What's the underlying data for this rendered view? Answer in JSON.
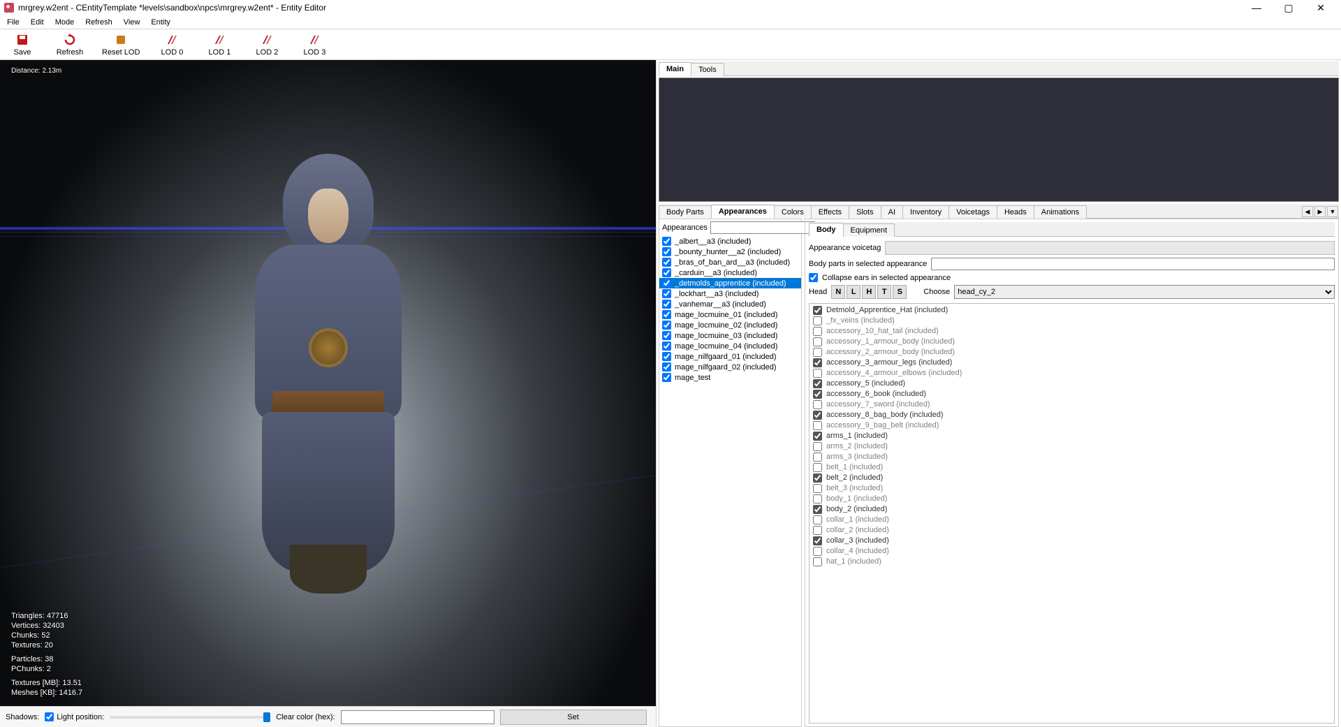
{
  "window": {
    "title": "mrgrey.w2ent - CEntityTemplate *levels\\sandbox\\npcs\\mrgrey.w2ent* - Entity Editor"
  },
  "menu": [
    "File",
    "Edit",
    "Mode",
    "Refresh",
    "View",
    "Entity"
  ],
  "toolbar": [
    {
      "name": "save",
      "label": "Save",
      "color": "#c21818"
    },
    {
      "name": "refresh",
      "label": "Refresh",
      "color": "#c21818"
    },
    {
      "name": "reset-lod",
      "label": "Reset LOD",
      "color": "#c97a1f"
    },
    {
      "name": "lod0",
      "label": "LOD 0",
      "color": "#b31a2a"
    },
    {
      "name": "lod1",
      "label": "LOD 1",
      "color": "#b31a2a"
    },
    {
      "name": "lod2",
      "label": "LOD 2",
      "color": "#b31a2a"
    },
    {
      "name": "lod3",
      "label": "LOD 3",
      "color": "#b31a2a"
    }
  ],
  "viewport": {
    "distance": "Distance: 2.13m",
    "stats": {
      "triangles": "Triangles: 47716",
      "vertices": "Vertices: 32403",
      "chunks": "Chunks: 52",
      "textures": "Textures: 20",
      "particles": "Particles: 38",
      "pchunks": "PChunks: 2",
      "texmb": "Textures [MB]: 13.51",
      "meshes": "Meshes [KB]: 1416.7"
    },
    "footer": {
      "shadows": "Shadows:",
      "light": "Light position:",
      "clear": "Clear color (hex):",
      "set": "Set"
    }
  },
  "main_tabs": [
    "Main",
    "Tools"
  ],
  "category_tabs": [
    "Body Parts",
    "Appearances",
    "Colors",
    "Effects",
    "Slots",
    "AI",
    "Inventory",
    "Voicetags",
    "Heads",
    "Animations"
  ],
  "category_active": "Appearances",
  "appearances_label": "Appearances",
  "appearances": [
    {
      "label": "_albert__a3 (included)",
      "checked": true,
      "sel": false
    },
    {
      "label": "_bounty_hunter__a2 (included)",
      "checked": true,
      "sel": false
    },
    {
      "label": "_bras_of_ban_ard__a3 (included)",
      "checked": true,
      "sel": false
    },
    {
      "label": "_carduin__a3 (included)",
      "checked": true,
      "sel": false
    },
    {
      "label": "_detmolds_apprentice (included)",
      "checked": true,
      "sel": true
    },
    {
      "label": "_lockhart__a3 (included)",
      "checked": true,
      "sel": false
    },
    {
      "label": "_vanhemar__a3 (included)",
      "checked": true,
      "sel": false
    },
    {
      "label": "mage_locmuine_01 (included)",
      "checked": true,
      "sel": false
    },
    {
      "label": "mage_locmuine_02 (included)",
      "checked": true,
      "sel": false
    },
    {
      "label": "mage_locmuine_03 (included)",
      "checked": true,
      "sel": false
    },
    {
      "label": "mage_locmuine_04 (included)",
      "checked": true,
      "sel": false
    },
    {
      "label": "mage_nilfgaard_01 (included)",
      "checked": true,
      "sel": false
    },
    {
      "label": "mage_nilfgaard_02 (included)",
      "checked": true,
      "sel": false
    },
    {
      "label": "mage_test",
      "checked": true,
      "sel": false
    }
  ],
  "body_tabs": [
    "Body",
    "Equipment"
  ],
  "body": {
    "voicetag_label": "Appearance voicetag",
    "bodyparts_label": "Body parts in selected appearance",
    "collapse_label": "Collapse ears in selected appearance",
    "head_label": "Head",
    "head_buttons": [
      "N",
      "L",
      "H",
      "T",
      "S"
    ],
    "choose_label": "Choose",
    "choose_value": "head_cy_2"
  },
  "includes": [
    {
      "label": "Detmold_Apprentice_Hat (included)",
      "on": true
    },
    {
      "label": "_fx_veins (included)",
      "on": false
    },
    {
      "label": "accessory_10_hat_tail (included)",
      "on": false
    },
    {
      "label": "accessory_1_armour_body (included)",
      "on": false
    },
    {
      "label": "accessory_2_armour_body (included)",
      "on": false
    },
    {
      "label": "accessory_3_armour_legs (included)",
      "on": true
    },
    {
      "label": "accessory_4_armour_elbows (included)",
      "on": false
    },
    {
      "label": "accessory_5 (included)",
      "on": true
    },
    {
      "label": "accessory_6_book (included)",
      "on": true
    },
    {
      "label": "accessory_7_sword (included)",
      "on": false
    },
    {
      "label": "accessory_8_bag_body (included)",
      "on": true
    },
    {
      "label": "accessory_9_bag_belt (included)",
      "on": false
    },
    {
      "label": "arms_1 (included)",
      "on": true
    },
    {
      "label": "arms_2 (included)",
      "on": false
    },
    {
      "label": "arms_3 (included)",
      "on": false
    },
    {
      "label": "belt_1 (included)",
      "on": false
    },
    {
      "label": "belt_2 (included)",
      "on": true
    },
    {
      "label": "belt_3 (included)",
      "on": false
    },
    {
      "label": "body_1 (included)",
      "on": false
    },
    {
      "label": "body_2 (included)",
      "on": true
    },
    {
      "label": "collar_1 (included)",
      "on": false
    },
    {
      "label": "collar_2 (included)",
      "on": false
    },
    {
      "label": "collar_3 (included)",
      "on": true
    },
    {
      "label": "collar_4 (included)",
      "on": false
    },
    {
      "label": "hat_1 (included)",
      "on": false
    }
  ]
}
